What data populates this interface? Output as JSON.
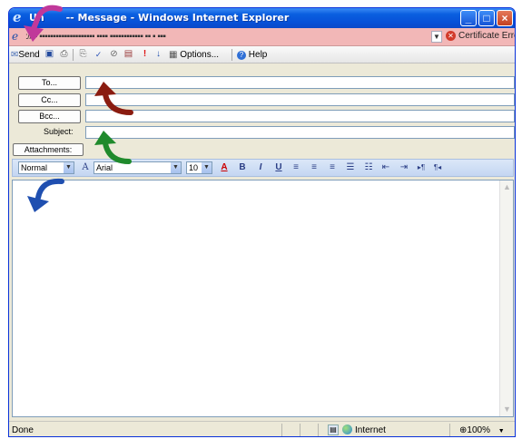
{
  "window": {
    "title_start": "Un",
    "title_rest": " -- Message - Windows Internet Explorer",
    "min_glyph": "_",
    "max_glyph": "□",
    "close_glyph": "×"
  },
  "address": {
    "url": "://▪▪ ▪▪▪▪▪▪▪▪▪▪▪▪▪▪▪▪▪▪▪▪ ▪▪▪▪ ▪▪▪▪▪▪▪▪▪▪▪▪ ▪▪ ▪ ▪▪▪",
    "cert_error": "Certificate Error"
  },
  "toolbar": {
    "send": "Send",
    "options": "Options...",
    "help": "Help"
  },
  "headers": {
    "to_label": "To...",
    "cc_label": "Cc...",
    "bcc_label": "Bcc...",
    "subject_label": "Subject:",
    "attachments_label": "Attachments:",
    "to_value": "",
    "cc_value": "",
    "bcc_value": "",
    "subject_value": ""
  },
  "format": {
    "style": "Normal",
    "font": "Arial",
    "size": "10",
    "bold": "B",
    "italic": "I",
    "underline": "U"
  },
  "status": {
    "left": "Done",
    "zone": "Internet",
    "zoom": "100%"
  },
  "colors": {
    "arrow_pink": "#c0389a",
    "arrow_red": "#8a1c10",
    "arrow_green": "#1f8a2c",
    "arrow_blue": "#1f4fb0",
    "address_bar_bg": "#f2b7b7"
  }
}
